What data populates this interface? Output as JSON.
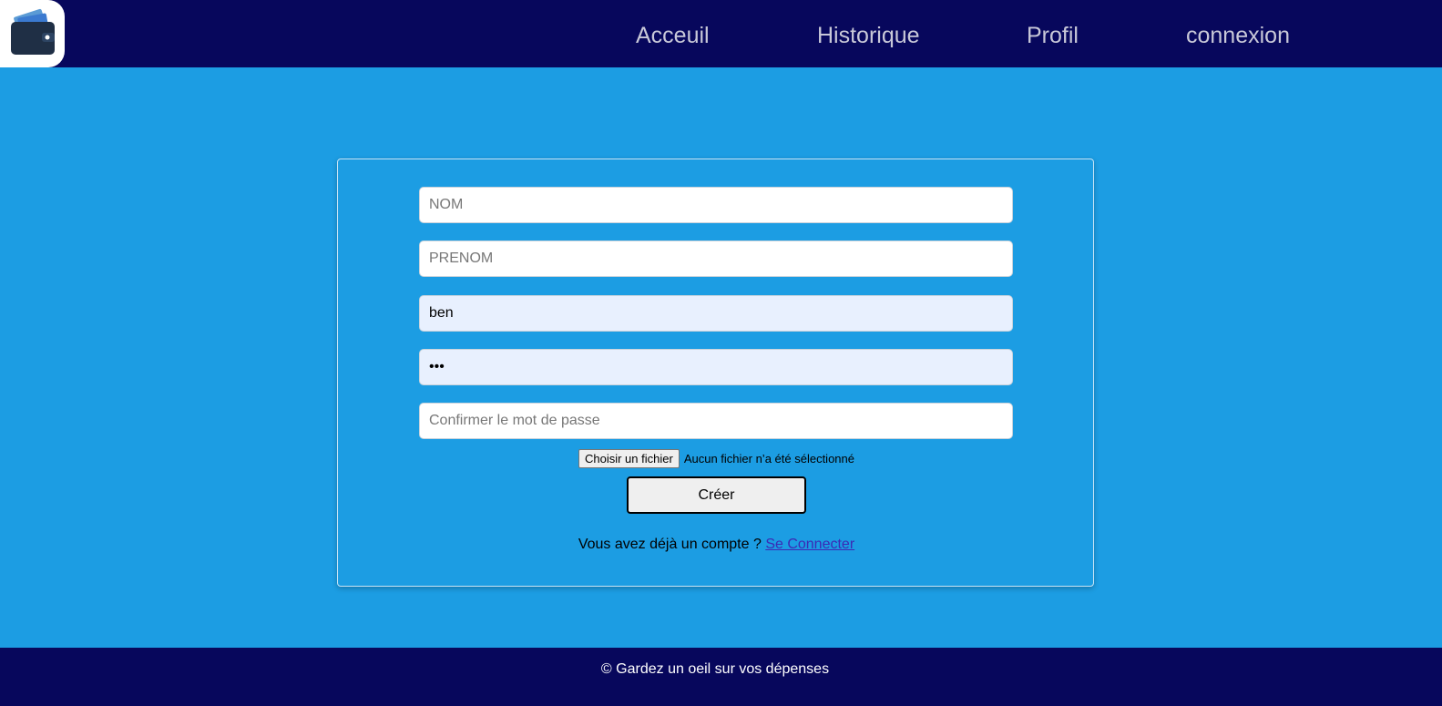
{
  "header": {
    "logo_icon": "wallet-icon",
    "nav": [
      {
        "label": "Acceuil"
      },
      {
        "label": "Historique"
      },
      {
        "label": "Profil"
      },
      {
        "label": "connexion"
      }
    ]
  },
  "form": {
    "nom": {
      "placeholder": "NOM",
      "value": ""
    },
    "prenom": {
      "placeholder": "PRENOM",
      "value": ""
    },
    "username": {
      "value": "ben"
    },
    "password": {
      "value": "•••"
    },
    "confirm": {
      "placeholder": "Confirmer le mot de passe",
      "value": ""
    },
    "file": {
      "button_label": "Choisir un fichier",
      "status": "Aucun fichier n’a été sélectionné"
    },
    "submit_label": "Créer",
    "login_prompt": "Vous avez déjà un compte ?",
    "login_link": "Se Connecter"
  },
  "footer": {
    "text": "© Gardez un oeil sur vos dépenses"
  },
  "colors": {
    "navbar": "#07075c",
    "background": "#1c9de3",
    "autofill": "#e8f0fe"
  }
}
